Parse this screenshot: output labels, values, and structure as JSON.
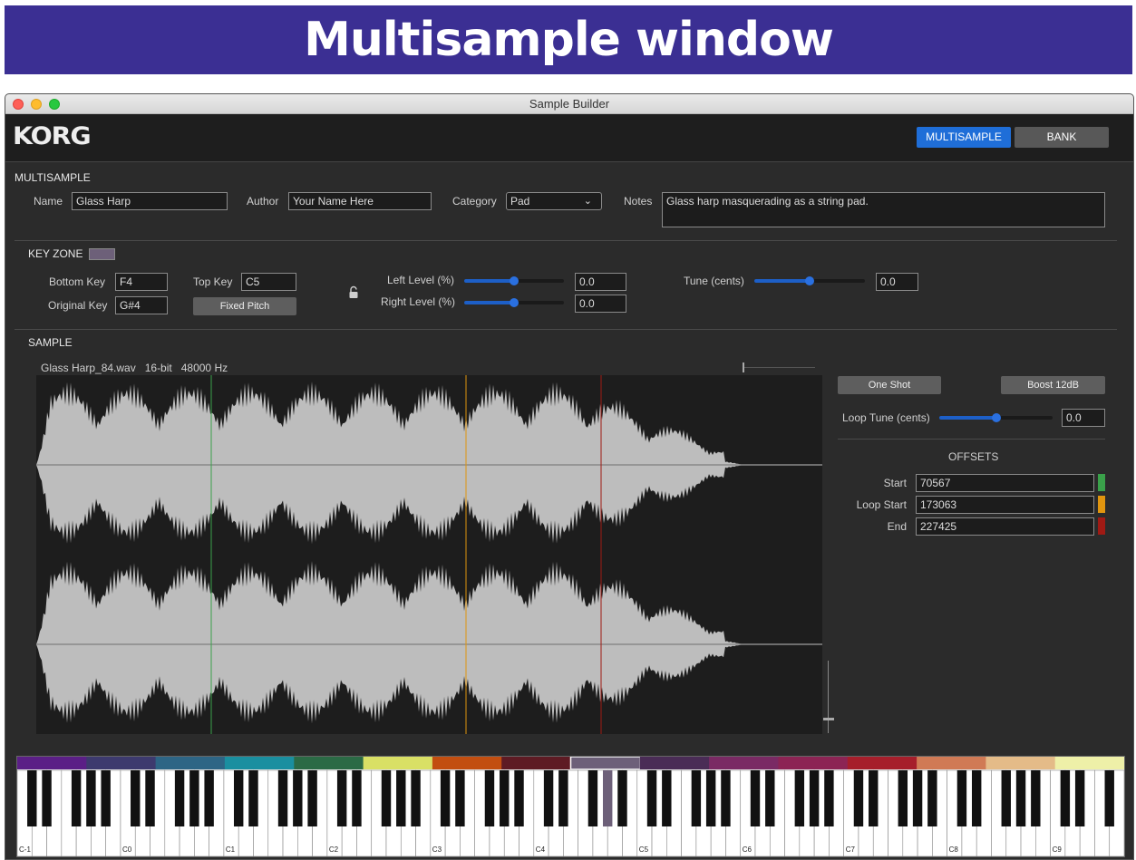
{
  "banner": {
    "title": "Multisample window"
  },
  "window": {
    "title": "Sample Builder"
  },
  "header": {
    "logo": "KORG",
    "tabs": [
      "MULTISAMPLE",
      "BANK"
    ],
    "active_tab": "MULTISAMPLE"
  },
  "multisample": {
    "section": "MULTISAMPLE",
    "name_label": "Name",
    "name_value": "Glass Harp",
    "author_label": "Author",
    "author_value": "Your Name Here",
    "category_label": "Category",
    "category_value": "Pad",
    "notes_label": "Notes",
    "notes_value": "Glass harp masquerading as a string pad."
  },
  "keyzone": {
    "section": "KEY ZONE",
    "zone_color": "#6d6079",
    "bottom_key_label": "Bottom Key",
    "bottom_key_value": "F4",
    "top_key_label": "Top Key",
    "top_key_value": "C5",
    "original_key_label": "Original Key",
    "original_key_value": "G#4",
    "fixed_pitch_label": "Fixed Pitch",
    "left_level_label": "Left Level (%)",
    "left_level_value": "0.0",
    "left_level_fraction": 0.5,
    "right_level_label": "Right Level (%)",
    "right_level_value": "0.0",
    "right_level_fraction": 0.5,
    "tune_label": "Tune (cents)",
    "tune_value": "0.0",
    "tune_fraction": 0.5
  },
  "sample": {
    "section": "SAMPLE",
    "file_info": "Glass Harp_84.wav   16-bit   48000 Hz",
    "one_shot_label": "One Shot",
    "boost_label": "Boost 12dB",
    "loop_tune_label": "Loop Tune (cents)",
    "loop_tune_value": "0.0",
    "loop_tune_fraction": 0.5,
    "offsets_title": "OFFSETS",
    "offsets": [
      {
        "label": "Start",
        "value": "70567",
        "color": "#3aa14a"
      },
      {
        "label": "Loop Start",
        "value": "173063",
        "color": "#e0950f"
      },
      {
        "label": "End",
        "value": "227425",
        "color": "#a01a14"
      }
    ]
  },
  "keyboard": {
    "octave_labels": [
      "C-1",
      "C0",
      "C1",
      "C2",
      "C3",
      "C4",
      "C5",
      "C6",
      "C7",
      "C8",
      "C9"
    ],
    "zone_colors": [
      "#5b1f86",
      "#3d3a6e",
      "#2d6585",
      "#1a8fa0",
      "#2b6a45",
      "#d9e065",
      "#c24e10",
      "#5e1b24",
      "#6d6079",
      "#4a2c56",
      "#7a2a64",
      "#8c2454",
      "#a61e2b",
      "#d07a55",
      "#e4bb88",
      "#eef0a8"
    ]
  }
}
